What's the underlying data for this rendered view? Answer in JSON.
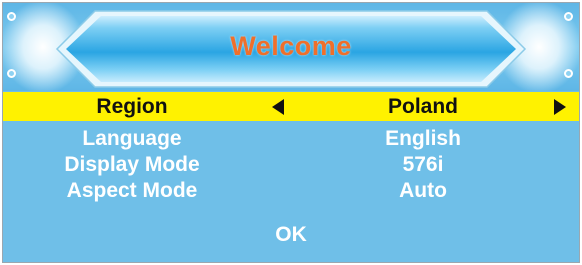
{
  "header": {
    "title": "Welcome",
    "title_color": "#ef6f2b"
  },
  "colors": {
    "panel_background": "#6fbfe8",
    "highlight_row": "#fff200",
    "text_normal": "#ffffff",
    "text_selected": "#111111"
  },
  "settings": {
    "region": {
      "label": "Region",
      "value": "Poland",
      "selected": true,
      "left_icon": "arrow-left-icon",
      "right_icon": "arrow-right-icon"
    },
    "language": {
      "label": "Language",
      "value": "English"
    },
    "display_mode": {
      "label": "Display Mode",
      "value": "576i"
    },
    "aspect_mode": {
      "label": "Aspect Mode",
      "value": "Auto"
    }
  },
  "ok_button": {
    "label": "OK"
  },
  "decorations": {
    "corner_icon": "ring-dot-icon"
  }
}
